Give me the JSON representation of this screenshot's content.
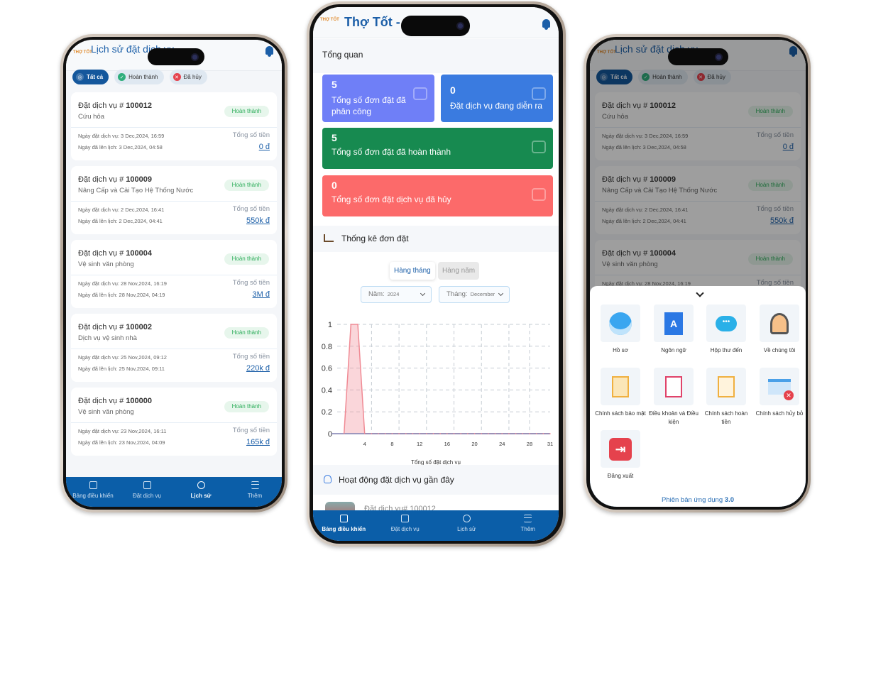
{
  "left_phone": {
    "header": {
      "title": "Lịch sử đặt dịch vụ",
      "logo": "THỢ TỐT"
    },
    "filters": [
      {
        "label": "Tất cả",
        "icon": "target-icon",
        "active": true
      },
      {
        "label": "Hoàn thành",
        "icon": "check-circle-icon",
        "active": false
      },
      {
        "label": "Đã hủy",
        "icon": "x-circle-icon",
        "active": false
      }
    ],
    "bookings": [
      {
        "title_prefix": "Đặt dịch vụ #",
        "id": "100012",
        "service": "Cứu hỏa",
        "status": "Hoàn thành",
        "booked_label": "Ngày đặt dịch vụ:",
        "booked": "3 Dec,2024, 16:59",
        "scheduled_label": "Ngày đã lên lịch:",
        "scheduled": "3 Dec,2024, 04:58",
        "total_label": "Tổng số tiền",
        "total": "0 đ"
      },
      {
        "title_prefix": "Đặt dịch vụ #",
        "id": "100009",
        "service": "Nâng Cấp và Cải Tạo Hệ Thống Nước",
        "status": "Hoàn thành",
        "booked_label": "Ngày đặt dịch vụ:",
        "booked": "2 Dec,2024, 16:41",
        "scheduled_label": "Ngày đã lên lịch:",
        "scheduled": "2 Dec,2024, 04:41",
        "total_label": "Tổng số tiền",
        "total": "550k đ"
      },
      {
        "title_prefix": "Đặt dịch vụ #",
        "id": "100004",
        "service": "Vệ sinh văn phòng",
        "status": "Hoàn thành",
        "booked_label": "Ngày đặt dịch vụ:",
        "booked": "28 Nov,2024, 16:19",
        "scheduled_label": "Ngày đã lên lịch:",
        "scheduled": "28 Nov,2024, 04:19",
        "total_label": "Tổng số tiền",
        "total": "3M đ"
      },
      {
        "title_prefix": "Đặt dịch vụ #",
        "id": "100002",
        "service": "Dịch vụ vệ sinh nhà",
        "status": "Hoàn thành",
        "booked_label": "Ngày đặt dịch vụ:",
        "booked": "25 Nov,2024, 09:12",
        "scheduled_label": "Ngày đã lên lịch:",
        "scheduled": "25 Nov,2024, 09:11",
        "total_label": "Tổng số tiền",
        "total": "220k đ"
      },
      {
        "title_prefix": "Đặt dịch vụ #",
        "id": "100000",
        "service": "Vệ sinh văn phòng",
        "status": "Hoàn thành",
        "booked_label": "Ngày đặt dịch vụ:",
        "booked": "23 Nov,2024, 16:11",
        "scheduled_label": "Ngày đã lên lịch:",
        "scheduled": "23 Nov,2024, 04:09",
        "total_label": "Tổng số tiền",
        "total": "165k đ"
      }
    ],
    "active_nav": 2
  },
  "nav": [
    {
      "label": "Bảng điều khiển",
      "icon": "dashboard-icon"
    },
    {
      "label": "Đặt dịch vụ",
      "icon": "clipboard-icon"
    },
    {
      "label": "Lịch sử",
      "icon": "history-icon"
    },
    {
      "label": "Thêm",
      "icon": "menu-icon"
    }
  ],
  "middle_phone": {
    "header": {
      "title": "Thợ Tốt -",
      "logo": "THỢ TỐT"
    },
    "overview_title": "Tổng quan",
    "stats": [
      {
        "value": "5",
        "label": "Tổng số đơn đặt đã phân công",
        "color": "#6f7ff7",
        "icon": "chart-growth-icon"
      },
      {
        "value": "0",
        "label": "Đặt dịch vụ đang diễn ra",
        "color": "#3a7be0",
        "icon": "gear-icon"
      },
      {
        "value": "5",
        "label": "Tổng số đơn đặt đã hoàn thành",
        "color": "#178a50",
        "icon": "people-icon"
      },
      {
        "value": "0",
        "label": "Tổng số đơn đặt dịch vụ đã hủy",
        "color": "#fc6a6a",
        "icon": "calendar-icon"
      }
    ],
    "stats_section_title": "Thống kê đơn đặt",
    "period_tabs": [
      {
        "label": "Hàng tháng",
        "active": true
      },
      {
        "label": "Hàng năm",
        "active": false
      }
    ],
    "year_select": {
      "label": "Năm:",
      "value": "2024"
    },
    "month_select": {
      "label": "Tháng:",
      "value": "December"
    },
    "recent_title": "Hoạt động đặt dịch vụ gần đây",
    "recent_peek": "Đặt dịch vụ# 100012",
    "active_nav": 0
  },
  "chart_data": {
    "type": "area",
    "x": [
      1,
      2,
      3,
      4,
      5,
      6,
      7,
      8,
      9,
      10,
      11,
      12,
      13,
      14,
      15,
      16,
      17,
      18,
      19,
      20,
      21,
      22,
      23,
      24,
      25,
      26,
      27,
      28,
      29,
      30,
      31
    ],
    "values": [
      0,
      1,
      1,
      0,
      0,
      0,
      0,
      0,
      0,
      0,
      0,
      0,
      0,
      0,
      0,
      0,
      0,
      0,
      0,
      0,
      0,
      0,
      0,
      0,
      0,
      0,
      0,
      0,
      0,
      0,
      0
    ],
    "xlabel": "Tổng số đặt dịch vụ",
    "ylabel": "",
    "xticks": [
      4,
      8,
      12,
      16,
      20,
      24,
      28,
      31
    ],
    "yticks": [
      "0",
      "0.2",
      "0.4",
      "0.6",
      "0.8",
      "1"
    ],
    "ylim": [
      0,
      1
    ],
    "xlim": [
      0,
      31
    ],
    "grid": true,
    "color": "#f08a94"
  },
  "right_phone": {
    "sheet": {
      "items": [
        {
          "label": "Hồ sơ",
          "icon": "profile-icon"
        },
        {
          "label": "Ngôn ngữ",
          "icon": "translate-icon"
        },
        {
          "label": "Hộp thư đến",
          "icon": "chat-icon"
        },
        {
          "label": "Về chúng tôi",
          "icon": "support-agent-icon"
        },
        {
          "label": "Chính sách bảo mật",
          "icon": "privacy-policy-icon"
        },
        {
          "label": "Điều khoản và Điều kiện",
          "icon": "terms-icon"
        },
        {
          "label": "Chính sách hoàn tiền",
          "icon": "refund-policy-icon"
        },
        {
          "label": "Chính sách hủy bỏ",
          "icon": "cancel-policy-icon"
        },
        {
          "label": "Đăng xuất",
          "icon": "logout-icon"
        }
      ],
      "version_label": "Phiên bản ứng dụng",
      "version": "3.0"
    },
    "active_nav": 2
  }
}
